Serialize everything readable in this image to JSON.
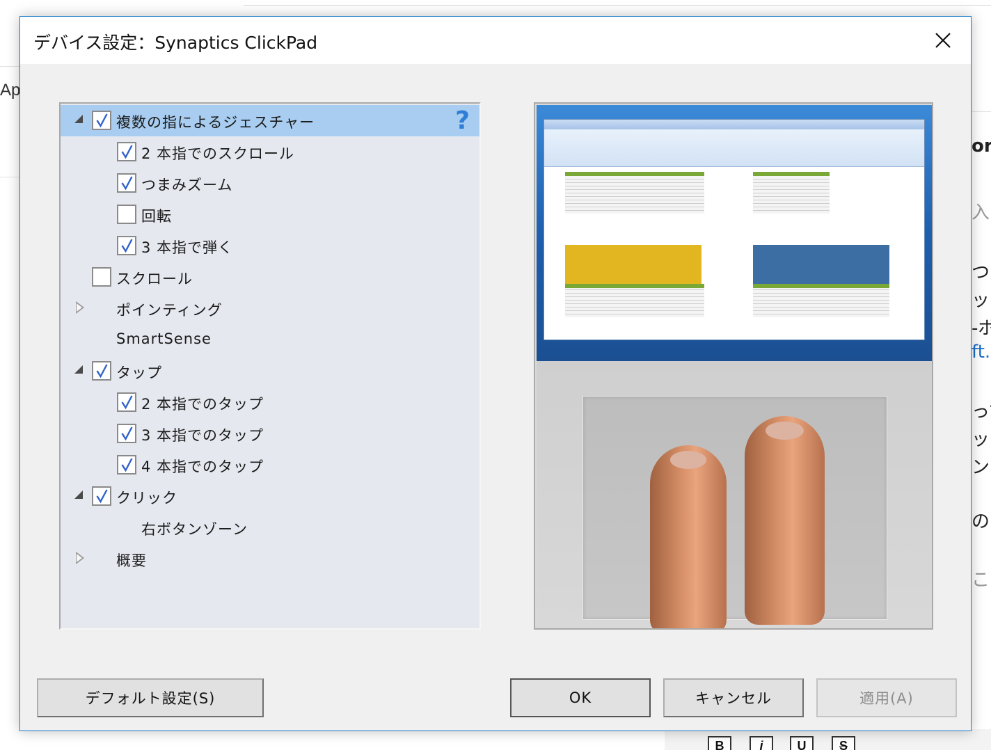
{
  "background_app": {
    "left_fragment": "App",
    "right_fragments": [
      "or",
      "入)",
      "つに",
      "ッ",
      "-ボ",
      "ft.c",
      "って",
      "ッ",
      "ンド",
      "のタ",
      "こで"
    ],
    "toolbar_buttons": [
      "B",
      "i",
      "U",
      "S"
    ]
  },
  "dialog": {
    "title": "デバイス設定：Synaptics ClickPad",
    "help_icon": "?",
    "tree": [
      {
        "label": "複数の指によるジェスチャー",
        "checked": true,
        "expander": "expanded",
        "level": 0,
        "selected": true
      },
      {
        "label": "2 本指でのスクロール",
        "checked": true,
        "level": 1
      },
      {
        "label": "つまみズーム",
        "checked": true,
        "level": 1
      },
      {
        "label": "回転",
        "checked": false,
        "level": 1
      },
      {
        "label": "3 本指で弾く",
        "checked": true,
        "level": 1
      },
      {
        "label": "スクロール",
        "checked": false,
        "level": 0
      },
      {
        "label": "ポインティング",
        "checkbox": false,
        "expander": "collapsed",
        "level": 0
      },
      {
        "label": "SmartSense",
        "checkbox": false,
        "level": 0
      },
      {
        "label": "タップ",
        "checked": true,
        "expander": "expanded",
        "level": 0
      },
      {
        "label": "2 本指でのタップ",
        "checked": true,
        "level": 1
      },
      {
        "label": "3 本指でのタップ",
        "checked": true,
        "level": 1
      },
      {
        "label": "4 本指でのタップ",
        "checked": true,
        "level": 1
      },
      {
        "label": "クリック",
        "checked": true,
        "expander": "expanded",
        "level": 0
      },
      {
        "label": "右ボタンゾーン",
        "checkbox": false,
        "level": 1
      },
      {
        "label": "概要",
        "checkbox": false,
        "expander": "collapsed",
        "level": 0
      }
    ],
    "buttons": {
      "default": "デフォルト設定(S)",
      "ok": "OK",
      "cancel": "キャンセル",
      "apply": "適用(A)"
    },
    "colors": {
      "accent_border": "#1979ca",
      "selected_row": "#a8cdf0",
      "help_icon": "#2f7fd6"
    }
  }
}
